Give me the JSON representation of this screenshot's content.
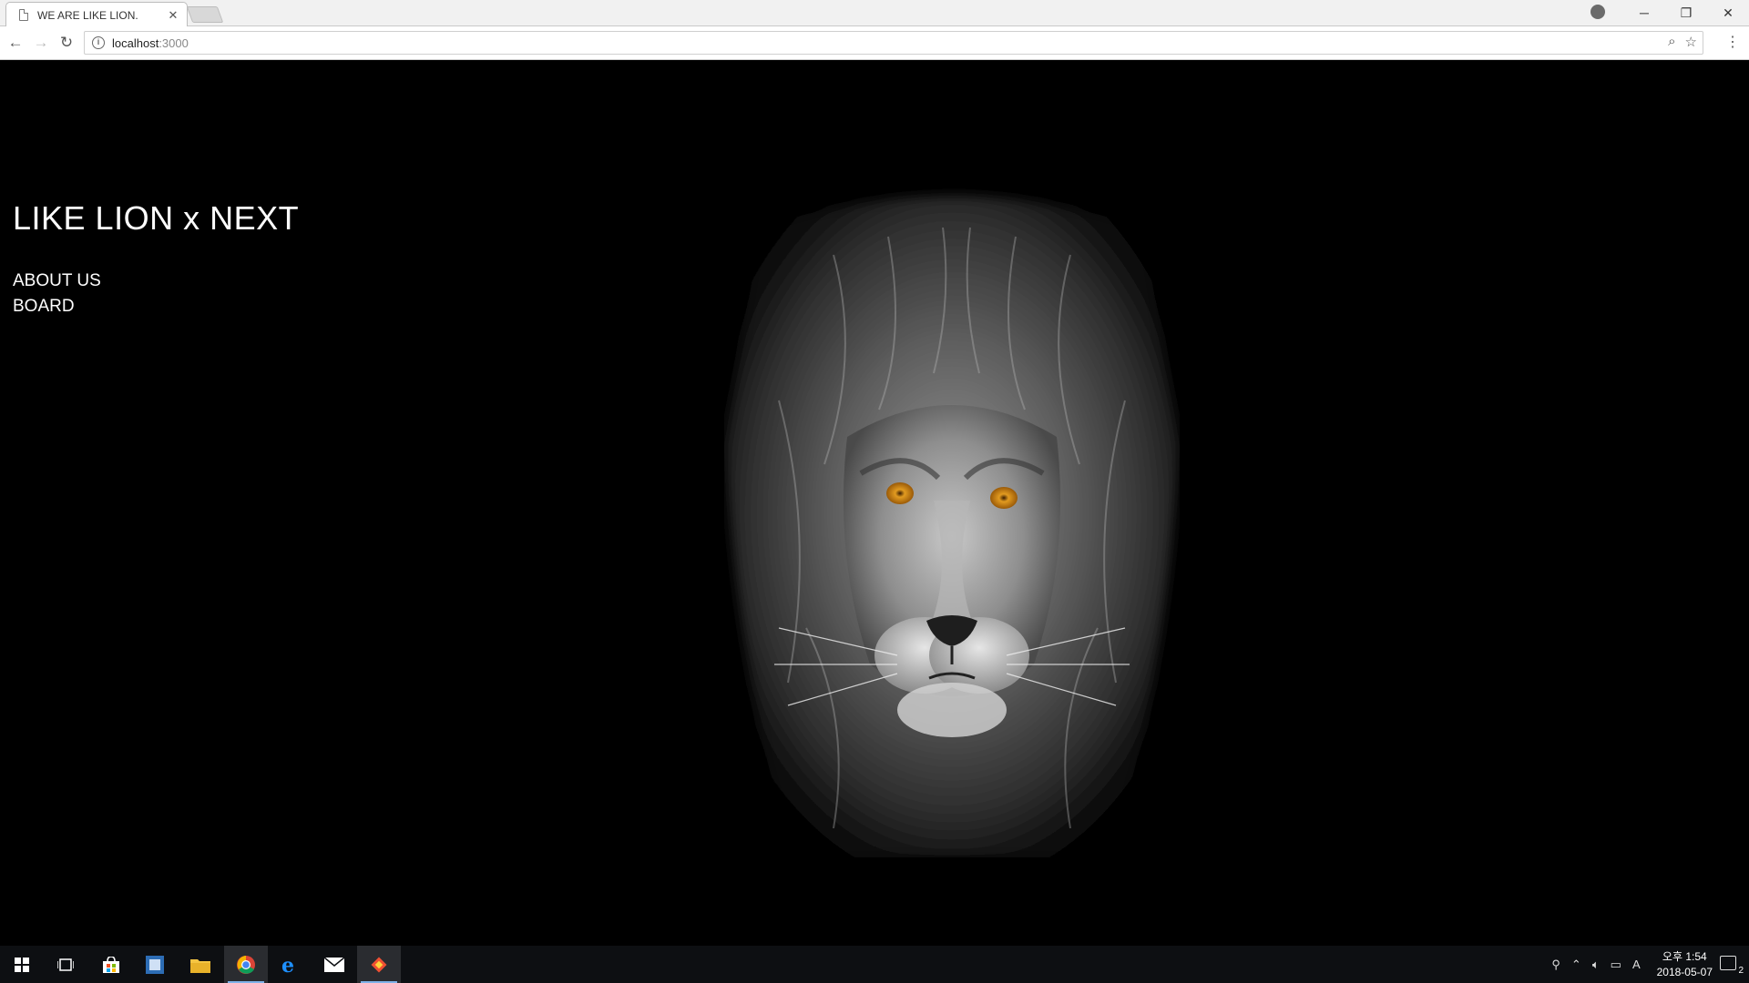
{
  "browser": {
    "tab_title": "WE ARE LIKE LION.",
    "tab_close": "✕",
    "url_host": "localhost",
    "url_rest": ":3000",
    "back": "←",
    "forward": "→",
    "reload": "↻",
    "zoom_icon": "⌕",
    "bookmark_icon": "☆",
    "menu_icon": "⋮",
    "minimize": "─",
    "restore": "❐",
    "close": "✕"
  },
  "site": {
    "title": "LIKE LION x NEXT",
    "nav": [
      {
        "label": "ABOUT US"
      },
      {
        "label": "BOARD"
      }
    ],
    "hero_icon": "lion-portrait"
  },
  "taskbar": {
    "apps": [
      "windows-start-icon",
      "task-view-icon",
      "store-icon",
      "outlook-icon",
      "file-explorer-icon",
      "chrome-icon",
      "edge-icon",
      "mail-icon",
      "git-icon"
    ],
    "clock_time": "오후 1:54",
    "clock_date": "2018-05-07",
    "ime": "A",
    "notification_count": "2"
  },
  "colors": {
    "page_bg": "#000000",
    "text": "#ffffff",
    "eye": "#d88a16",
    "taskbar_bg": "#0d0f12",
    "taskbar_active_underline": "#7fb2e8"
  }
}
